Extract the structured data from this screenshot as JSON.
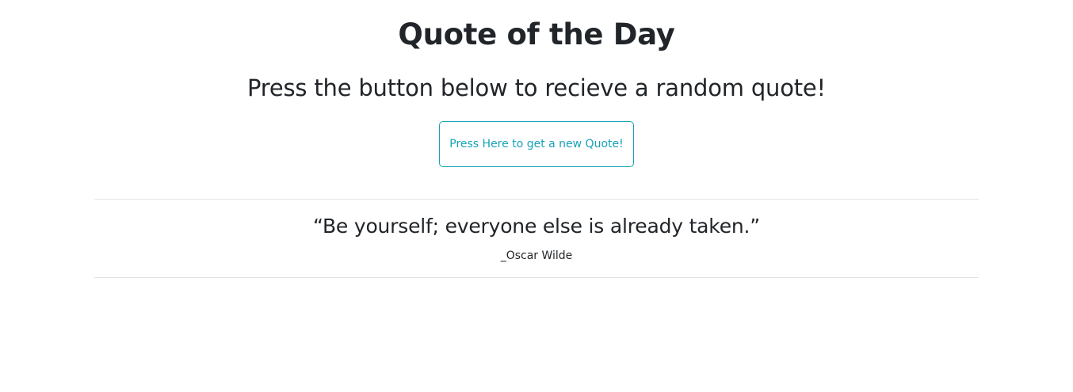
{
  "header": {
    "title": "Quote of the Day",
    "subtitle": "Press the button below to recieve a random quote!"
  },
  "action": {
    "button_label": "Press Here to get a new Quote!",
    "accent_color": "#17a2b8"
  },
  "quote": {
    "text": "“Be yourself; everyone else is already taken.”",
    "author": "_Oscar Wilde"
  }
}
